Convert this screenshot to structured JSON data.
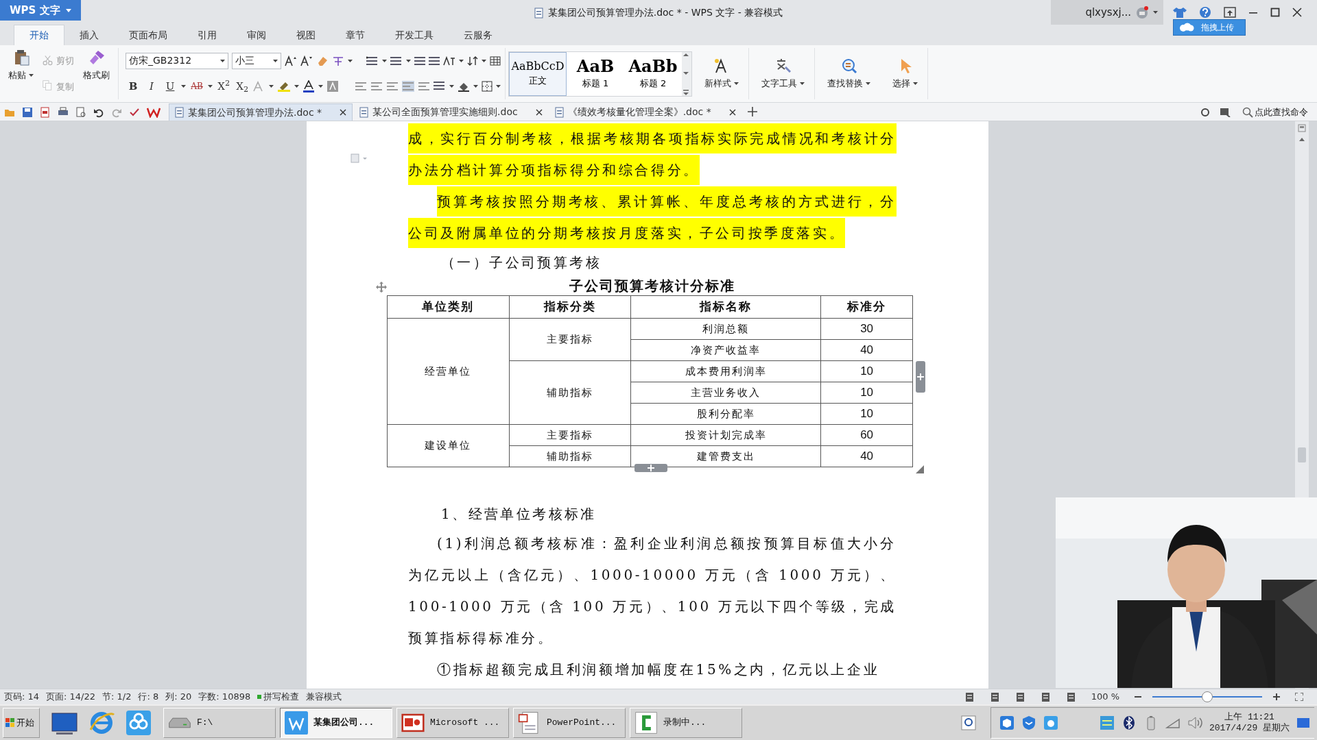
{
  "window": {
    "app_menu": "WPS 文字",
    "title": "某集团公司预算管理办法.doc * - WPS 文字 - 兼容模式",
    "user": "qlxysxj...",
    "upload_button": "拖拽上传"
  },
  "menu_tabs": [
    {
      "label": "开始",
      "selected": true
    },
    {
      "label": "插入",
      "selected": false
    },
    {
      "label": "页面布局",
      "selected": false
    },
    {
      "label": "引用",
      "selected": false
    },
    {
      "label": "审阅",
      "selected": false
    },
    {
      "label": "视图",
      "selected": false
    },
    {
      "label": "章节",
      "selected": false
    },
    {
      "label": "开发工具",
      "selected": false
    },
    {
      "label": "云服务",
      "selected": false
    }
  ],
  "ribbon": {
    "clipboard": [
      {
        "label": "粘贴",
        "disabled": false
      },
      {
        "label": "剪切",
        "disabled": true
      },
      {
        "label": "复制",
        "disabled": true
      },
      {
        "label": "格式刷",
        "disabled": false
      }
    ],
    "font": "仿宋_GB2312",
    "font_size": "小三",
    "format_buttons": [
      {
        "label": "B",
        "kind": "bold"
      },
      {
        "label": "I",
        "kind": "italic"
      },
      {
        "label": "U",
        "kind": "underline"
      },
      {
        "label": "AB",
        "kind": "strike"
      },
      {
        "label": "X$^{2}$",
        "kind": "plain"
      },
      {
        "label": "X$_{2}$",
        "kind": "plain"
      }
    ],
    "styles": [
      {
        "sample": "AaBbCcD",
        "label": "正文",
        "selected": true
      },
      {
        "sample": "AaB",
        "label": "标题 1",
        "selected": false
      },
      {
        "sample": "AaBb",
        "label": "标题 2",
        "selected": false
      }
    ],
    "tools": [
      "新样式",
      "文字工具",
      "查找替换",
      "选择"
    ]
  },
  "doc_tabs": [
    {
      "label": "某集团公司预算管理办法.doc *",
      "selected": true
    },
    {
      "label": "某公司全面预算管理实施细则.doc",
      "selected": false
    },
    {
      "label": "《绩效考核量化管理全案》.doc *",
      "selected": false
    }
  ],
  "command_search": "点此查找命令",
  "document": {
    "blocks": [
      {
        "kind": "paragraph",
        "text": "成，实行百分制考核，根据考核期各项指标实际完成情况和考核计分办法分档计算分项指标得分和综合得分。",
        "highlighted": true,
        "indent": false
      },
      {
        "kind": "paragraph",
        "text": "预算考核按照分期考核、累计算帐、年度总考核的方式进行，分公司及附属单位的分期考核按月度落实，子公司按季度落实。",
        "highlighted": true,
        "indent": true
      },
      {
        "kind": "heading",
        "text": "（一）子公司预算考核",
        "highlighted": false,
        "indent": true
      },
      {
        "kind": "table",
        "caption": "子公司预算考核计分标准",
        "columns": [
          "单位类别",
          "指标分类",
          "指标名称",
          "标准分"
        ],
        "groups": [
          {
            "unit": "经营单位",
            "categories": [
              {
                "name": "主要指标",
                "items": [
                  {
                    "name": "利润总额",
                    "score": "30"
                  },
                  {
                    "name": "净资产收益率",
                    "score": "40"
                  }
                ]
              },
              {
                "name": "辅助指标",
                "items": [
                  {
                    "name": "成本费用利润率",
                    "score": "10"
                  },
                  {
                    "name": "主营业务收入",
                    "score": "10"
                  },
                  {
                    "name": "股利分配率",
                    "score": "10"
                  }
                ]
              }
            ]
          },
          {
            "unit": "建设单位",
            "categories": [
              {
                "name": "主要指标",
                "items": [
                  {
                    "name": "投资计划完成率",
                    "score": "60"
                  }
                ]
              },
              {
                "name": "辅助指标",
                "items": [
                  {
                    "name": "建管费支出",
                    "score": "40"
                  }
                ]
              }
            ]
          }
        ]
      },
      {
        "kind": "heading",
        "text": "1、经营单位考核标准",
        "highlighted": false,
        "indent": true
      },
      {
        "kind": "paragraph",
        "text": "(1)利润总额考核标准：盈利企业利润总额按预算目标值大小分为亿元以上（含亿元）、1000-10000 万元（含 1000 万元）、100-1000 万元（含 100 万元）、100 万元以下四个等级，完成预算指标得标准分。",
        "highlighted": false,
        "indent": true
      },
      {
        "kind": "paragraph",
        "text": "①指标超额完成且利润额增加幅度在15%之内，亿元以上企业",
        "highlighted": false,
        "indent": true
      }
    ]
  },
  "status_bar": {
    "fields": [
      "页码: 14",
      "页面: 14/22",
      "节: 1/2",
      "行: 8",
      "列: 20",
      "字数: 10898"
    ],
    "spell_check": "拼写检查",
    "mode": "兼容模式",
    "zoom": "100 %",
    "zoom_slider": {
      "level": 0.5
    }
  },
  "taskbar": {
    "start": "开始",
    "tasks": [
      {
        "label": "F:\\",
        "kind": "drive",
        "selected": false
      },
      {
        "label": "某集团公司...",
        "kind": "writer",
        "selected": true
      },
      {
        "label": "Microsoft ...",
        "kind": "presenter",
        "selected": false
      },
      {
        "label": "PowerPoint...",
        "kind": "document",
        "selected": false
      },
      {
        "label": "录制中...",
        "kind": "recorder",
        "selected": false
      }
    ],
    "clock": {
      "time": "上午 11:21",
      "date": "2017/4/29 星期六"
    }
  }
}
